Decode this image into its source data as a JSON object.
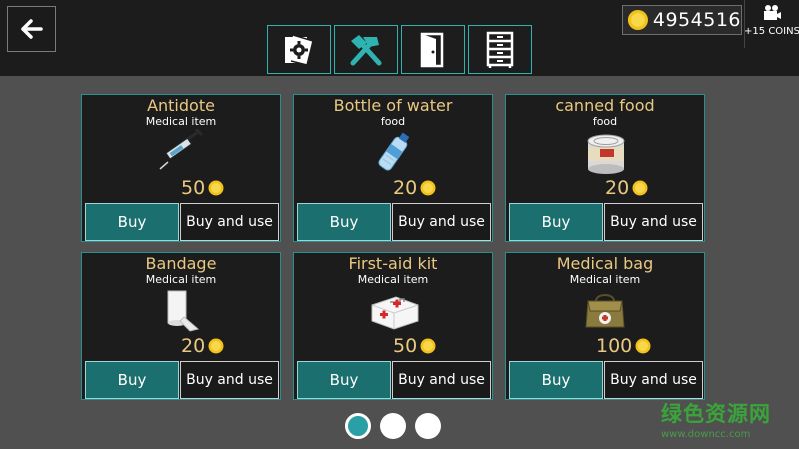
{
  "header": {
    "back_icon": "arrow-left-icon",
    "tabs": [
      {
        "icon": "blueprint-gear-icon",
        "active": false
      },
      {
        "icon": "crossed-hammers-icon",
        "active": true
      },
      {
        "icon": "door-icon",
        "active": false
      },
      {
        "icon": "cabinet-drawers-icon",
        "active": false
      }
    ],
    "coins": "4954516",
    "video_bonus_label": "+15 COINS"
  },
  "colors": {
    "accent": "#2fb3b0",
    "price_gold": "#e9c982",
    "buy_button": "#1b6f6e"
  },
  "items": [
    {
      "name": "Antidote",
      "category": "Medical item",
      "price": "50",
      "icon": "syringe-icon",
      "buy_label": "Buy",
      "buy_use_label": "Buy and use"
    },
    {
      "name": "Bottle of water",
      "category": "food",
      "price": "20",
      "icon": "water-bottle-icon",
      "buy_label": "Buy",
      "buy_use_label": "Buy and use"
    },
    {
      "name": "canned food",
      "category": "food",
      "price": "20",
      "icon": "tin-can-icon",
      "buy_label": "Buy",
      "buy_use_label": "Buy and use"
    },
    {
      "name": "Bandage",
      "category": "Medical item",
      "price": "20",
      "icon": "bandage-roll-icon",
      "buy_label": "Buy",
      "buy_use_label": "Buy and use"
    },
    {
      "name": "First-aid kit",
      "category": "Medical item",
      "price": "50",
      "icon": "first-aid-kit-icon",
      "buy_label": "Buy",
      "buy_use_label": "Buy and use"
    },
    {
      "name": "Medical bag",
      "category": "Medical item",
      "price": "100",
      "icon": "medical-bag-icon",
      "buy_label": "Buy",
      "buy_use_label": "Buy and use"
    }
  ],
  "pagination": {
    "pages": 3,
    "current": 1
  },
  "watermark": {
    "text_cn": "绿色资源网",
    "url": "www.downcc.com"
  }
}
